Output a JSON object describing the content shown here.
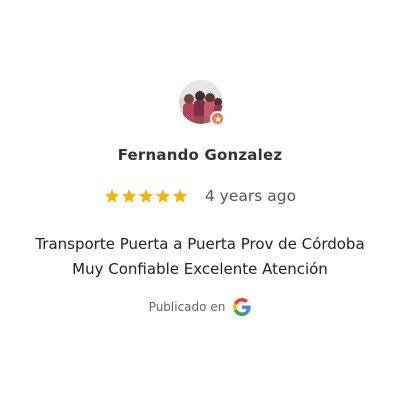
{
  "reviewer": {
    "name": "Fernando Gonzalez"
  },
  "rating": {
    "value": 5,
    "max": 5,
    "time_ago": "4 years ago",
    "star_color": "#f5b400"
  },
  "review": {
    "lines": [
      "Transporte Puerta a Puerta Prov de Córdoba",
      "Muy Confiable Excelente Atención"
    ]
  },
  "source": {
    "label": "Publicado en",
    "icon": "google-icon"
  },
  "badge": {
    "icon": "local-guide-star-icon",
    "color": "#ff7043"
  }
}
